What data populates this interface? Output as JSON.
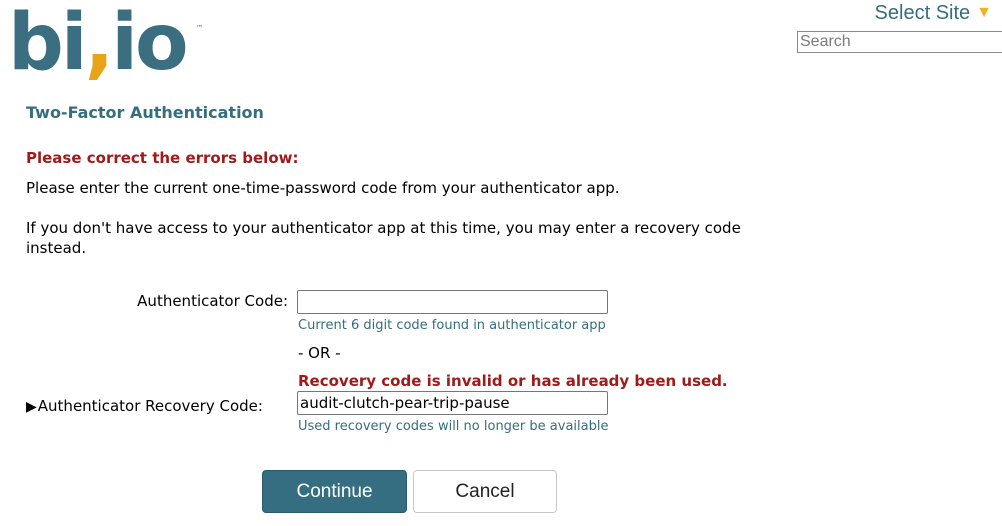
{
  "header": {
    "logo_text": "bivio",
    "logo_tm": "™",
    "select_site_label": "Select Site",
    "select_site_icon": "triangle-down-icon",
    "search_placeholder": "Search",
    "search_value": ""
  },
  "page": {
    "title": "Two-Factor Authentication",
    "error_header": "Please correct the errors below:",
    "instructions": "Please enter the current one-time-password code from your authenticator app.",
    "recovery_note": "If you don't have access to your authenticator app at this time, you may enter a recovery code instead."
  },
  "form": {
    "auth_code": {
      "label": "Authenticator Code:",
      "value": "",
      "hint": "Current 6 digit code found in authenticator app"
    },
    "or_separator": "- OR -",
    "recovery_code": {
      "expander_icon": "triangle-right-icon",
      "label": "Authenticator Recovery Code:",
      "error": "Recovery code is invalid or has already been used.",
      "value": "audit-clutch-pear-trip-pause",
      "hint": "Used recovery codes will no longer be available"
    },
    "continue_label": "Continue",
    "cancel_label": "Cancel"
  },
  "colors": {
    "brand_teal": "#356e80",
    "logo_comma": "#e8a317",
    "select_triangle": "#f0b323",
    "error_red": "#a01a1a"
  }
}
